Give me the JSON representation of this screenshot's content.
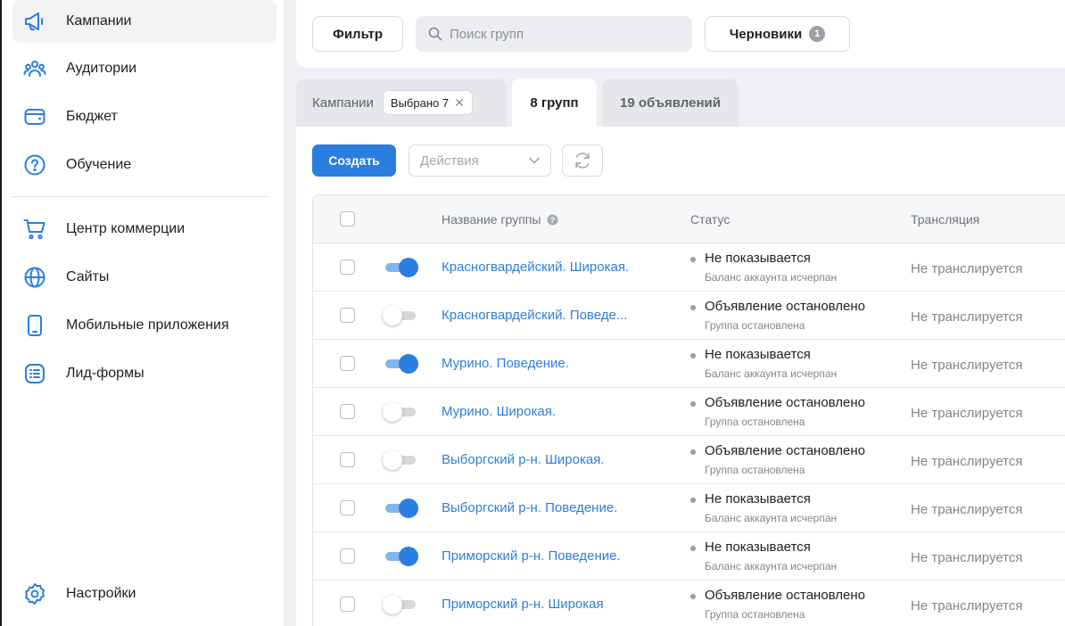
{
  "sidebar": {
    "items": [
      {
        "label": "Кампании",
        "icon": "megaphone-icon",
        "active": true
      },
      {
        "label": "Аудитории",
        "icon": "users-icon"
      },
      {
        "label": "Бюджет",
        "icon": "wallet-icon"
      },
      {
        "label": "Обучение",
        "icon": "help-circle-icon"
      },
      {
        "label": "Центр коммерции",
        "icon": "cart-icon"
      },
      {
        "label": "Сайты",
        "icon": "globe-icon"
      },
      {
        "label": "Мобильные приложения",
        "icon": "smartphone-icon"
      },
      {
        "label": "Лид-формы",
        "icon": "list-form-icon"
      }
    ],
    "settings_label": "Настройки"
  },
  "topbar": {
    "filter_label": "Фильтр",
    "search_placeholder": "Поиск групп",
    "drafts_label": "Черновики",
    "drafts_count": "1"
  },
  "tabs": {
    "campaigns_label": "Кампании",
    "campaigns_chip": "Выбрано 7",
    "groups_label": "8 групп",
    "ads_label": "19 объявлений"
  },
  "toolbar": {
    "create_label": "Создать",
    "actions_placeholder": "Действия"
  },
  "table": {
    "headers": {
      "name": "Название группы",
      "status": "Статус",
      "broadcast": "Трансляция"
    },
    "rows": [
      {
        "enabled": true,
        "name": "Красногвардейский. Широкая.",
        "status": "Не показывается",
        "status_sub": "Баланс аккаунта исчерпан",
        "broadcast": "Не транслируется"
      },
      {
        "enabled": false,
        "name": "Красногвардейский. Поведе...",
        "status": "Объявление остановлено",
        "status_sub": "Группа остановлена",
        "broadcast": "Не транслируется"
      },
      {
        "enabled": true,
        "name": "Мурино. Поведение.",
        "status": "Не показывается",
        "status_sub": "Баланс аккаунта исчерпан",
        "broadcast": "Не транслируется"
      },
      {
        "enabled": false,
        "name": "Мурино. Широкая.",
        "status": "Объявление остановлено",
        "status_sub": "Группа остановлена",
        "broadcast": "Не транслируется"
      },
      {
        "enabled": false,
        "name": "Выборгский р-н. Широкая.",
        "status": "Объявление остановлено",
        "status_sub": "Группа остановлена",
        "broadcast": "Не транслируется"
      },
      {
        "enabled": true,
        "name": "Выборгский р-н. Поведение.",
        "status": "Не показывается",
        "status_sub": "Баланс аккаунта исчерпан",
        "broadcast": "Не транслируется"
      },
      {
        "enabled": true,
        "name": "Приморский р-н. Поведение.",
        "status": "Не показывается",
        "status_sub": "Баланс аккаунта исчерпан",
        "broadcast": "Не транслируется"
      },
      {
        "enabled": false,
        "name": "Приморский р-н. Широкая",
        "status": "Объявление остановлено",
        "status_sub": "Группа остановлена",
        "broadcast": "Не транслируется"
      }
    ]
  },
  "colors": {
    "accent": "#2a7ee0",
    "toggle_on_track": "#84b4ee",
    "background": "#eef0f3"
  }
}
